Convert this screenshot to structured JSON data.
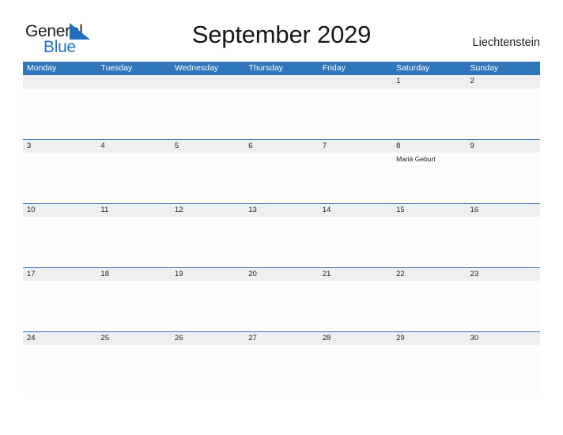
{
  "brand": {
    "name_part1": "General",
    "name_part2": "Blue",
    "sail_icon": "sail-triangle-icon",
    "color_primary": "#2370c4",
    "color_text": "#1b1b1b"
  },
  "header": {
    "title": "September 2029",
    "country": "Liechtenstein",
    "header_bg": "#2f76ba",
    "band_bg": "#efefef"
  },
  "weekdays": [
    "Monday",
    "Tuesday",
    "Wednesday",
    "Thursday",
    "Friday",
    "Saturday",
    "Sunday"
  ],
  "weeks": [
    {
      "days": [
        {
          "date": "",
          "event": ""
        },
        {
          "date": "",
          "event": ""
        },
        {
          "date": "",
          "event": ""
        },
        {
          "date": "",
          "event": ""
        },
        {
          "date": "",
          "event": ""
        },
        {
          "date": "1",
          "event": ""
        },
        {
          "date": "2",
          "event": ""
        }
      ]
    },
    {
      "days": [
        {
          "date": "3",
          "event": ""
        },
        {
          "date": "4",
          "event": ""
        },
        {
          "date": "5",
          "event": ""
        },
        {
          "date": "6",
          "event": ""
        },
        {
          "date": "7",
          "event": ""
        },
        {
          "date": "8",
          "event": "Mariä Geburt"
        },
        {
          "date": "9",
          "event": ""
        }
      ]
    },
    {
      "days": [
        {
          "date": "10",
          "event": ""
        },
        {
          "date": "11",
          "event": ""
        },
        {
          "date": "12",
          "event": ""
        },
        {
          "date": "13",
          "event": ""
        },
        {
          "date": "14",
          "event": ""
        },
        {
          "date": "15",
          "event": ""
        },
        {
          "date": "16",
          "event": ""
        }
      ]
    },
    {
      "days": [
        {
          "date": "17",
          "event": ""
        },
        {
          "date": "18",
          "event": ""
        },
        {
          "date": "19",
          "event": ""
        },
        {
          "date": "20",
          "event": ""
        },
        {
          "date": "21",
          "event": ""
        },
        {
          "date": "22",
          "event": ""
        },
        {
          "date": "23",
          "event": ""
        }
      ]
    },
    {
      "days": [
        {
          "date": "24",
          "event": ""
        },
        {
          "date": "25",
          "event": ""
        },
        {
          "date": "26",
          "event": ""
        },
        {
          "date": "27",
          "event": ""
        },
        {
          "date": "28",
          "event": ""
        },
        {
          "date": "29",
          "event": ""
        },
        {
          "date": "30",
          "event": ""
        }
      ]
    }
  ]
}
